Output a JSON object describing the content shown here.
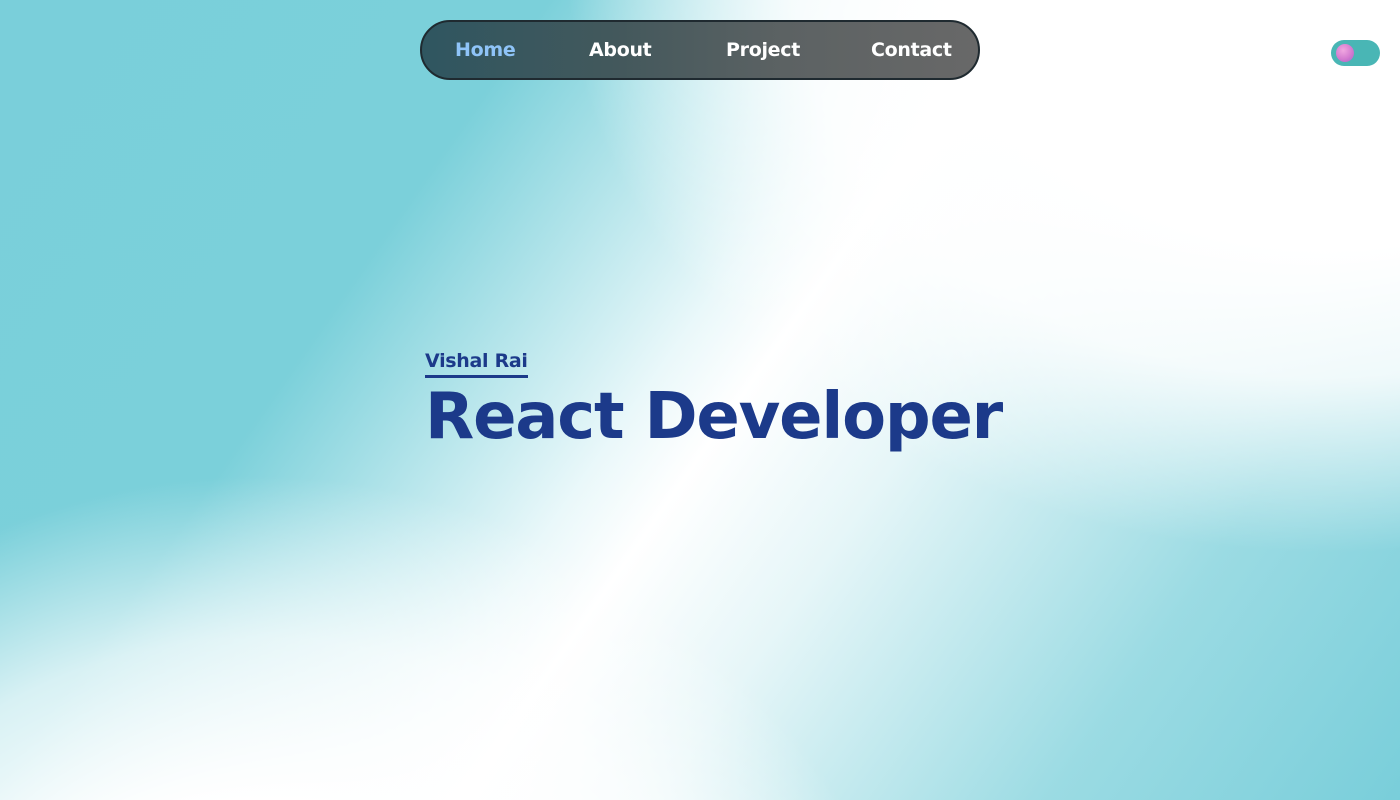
{
  "nav": {
    "items": [
      {
        "label": "Home",
        "active": true
      },
      {
        "label": "About",
        "active": false
      },
      {
        "label": "Project",
        "active": false
      },
      {
        "label": "Contact",
        "active": false
      }
    ]
  },
  "theme_toggle": {
    "icon": "theme-toggle-icon"
  },
  "hero": {
    "name": "Vishal Rai",
    "title": "React Developer"
  },
  "colors": {
    "accent_text": "#1c3a8a",
    "active_nav": "#8fc4f8",
    "toggle_track": "#49b6b5",
    "background_teal": "#7acfda"
  }
}
